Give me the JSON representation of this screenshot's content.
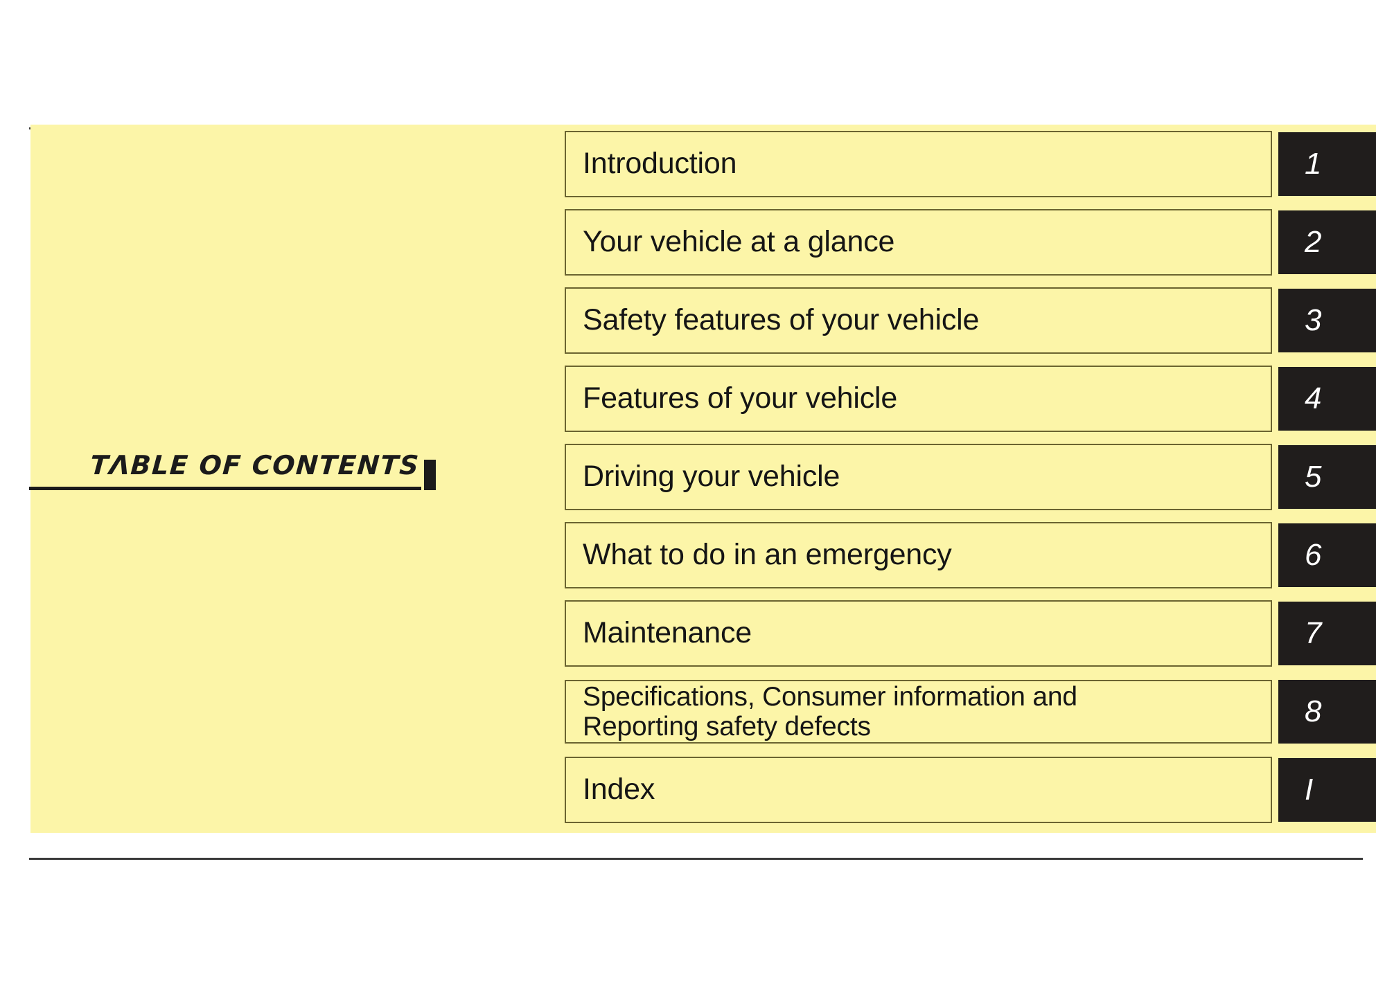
{
  "document": {
    "type": "vehicle-owners-manual-table-of-contents",
    "page_title": "TΛBLE OF CONTENTS",
    "colors": {
      "panel_background": "#FCF5A8",
      "box_border": "#6b6430",
      "tab_background": "#201d1c",
      "tab_number": "#ffffff",
      "rule": "#3b3b3b",
      "text": "#151515"
    }
  },
  "contents": {
    "entries": [
      {
        "label": "Introduction",
        "tab": "1",
        "lines": 1
      },
      {
        "label": "Your vehicle at a glance",
        "tab": "2",
        "lines": 1
      },
      {
        "label": "Safety features of your vehicle",
        "tab": "3",
        "lines": 1
      },
      {
        "label": "Features of your vehicle",
        "tab": "4",
        "lines": 1
      },
      {
        "label": "Driving your vehicle",
        "tab": "5",
        "lines": 1
      },
      {
        "label": "What to do in an emergency",
        "tab": "6",
        "lines": 1
      },
      {
        "label": "Maintenance",
        "tab": "7",
        "lines": 1
      },
      {
        "label": "Specifications, Consumer information and\nReporting safety defects",
        "tab": "8",
        "lines": 2
      },
      {
        "label": "Index",
        "tab": "I",
        "lines": 1
      }
    ]
  }
}
